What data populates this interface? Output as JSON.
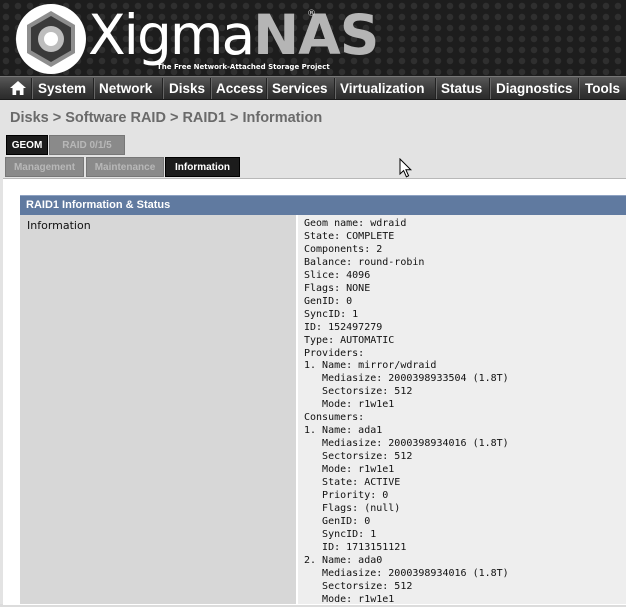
{
  "header": {
    "logo_text_a": "Xigma",
    "logo_text_b": "NAS",
    "registered": "®",
    "tagline": "The Free Network-Attached Storage Project",
    "logo_icon": "xigmanas-logo-icon"
  },
  "nav": {
    "home_icon": "home-icon",
    "items": [
      "System",
      "Network",
      "Disks",
      "Access",
      "Services",
      "Virtualization",
      "Status",
      "Diagnostics",
      "Tools"
    ]
  },
  "breadcrumb": "Disks > Software RAID > RAID1 > Information",
  "tabs_row1": [
    "GEOM",
    "RAID 0/1/5"
  ],
  "tabs_row2": [
    "Management",
    "Maintenance",
    "Information"
  ],
  "panel": {
    "title": "RAID1 Information & Status",
    "label": "Information",
    "lines": [
      "Geom name: wdraid",
      "State: COMPLETE",
      "Components: 2",
      "Balance: round-robin",
      "Slice: 4096",
      "Flags: NONE",
      "GenID: 0",
      "SyncID: 1",
      "ID: 152497279",
      "Type: AUTOMATIC",
      "Providers:",
      "1. Name: mirror/wdraid",
      "   Mediasize: 2000398933504 (1.8T)",
      "   Sectorsize: 512",
      "   Mode: r1w1e1",
      "Consumers:",
      "1. Name: ada1",
      "   Mediasize: 2000398934016 (1.8T)",
      "   Sectorsize: 512",
      "   Mode: r1w1e1",
      "   State: ACTIVE",
      "   Priority: 0",
      "   Flags: (null)",
      "   GenID: 0",
      "   SyncID: 1",
      "   ID: 1713151121",
      "2. Name: ada0",
      "   Mediasize: 2000398934016 (1.8T)",
      "   Sectorsize: 512",
      "   Mode: r1w1e1"
    ]
  },
  "colors": {
    "panel_header": "#607aa0",
    "active_tab": "#1c1c1c",
    "inactive_tab": "#8a8a8a"
  }
}
